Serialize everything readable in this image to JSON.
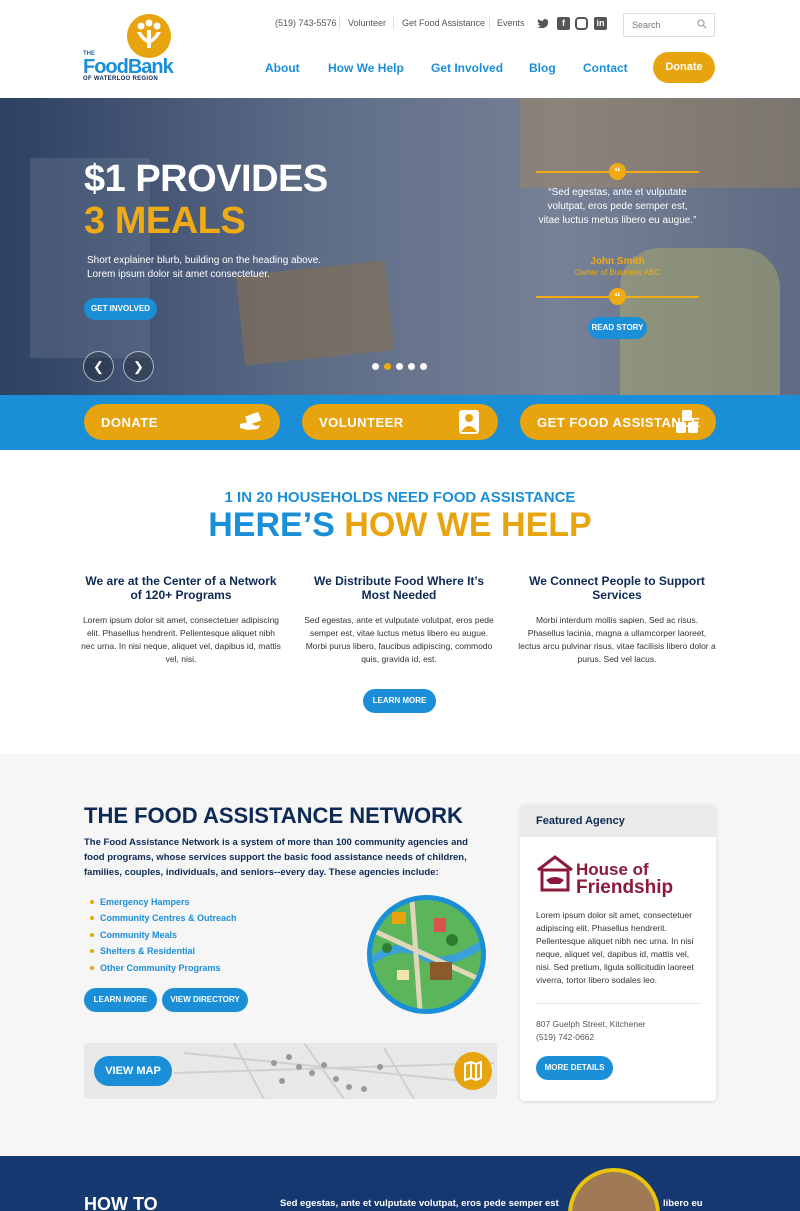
{
  "header": {
    "logo": {
      "the": "THE",
      "name": "FoodBank",
      "sub": "OF WATERLOO REGION"
    },
    "utility": {
      "phone": "(519) 743-5576",
      "volunteer": "Volunteer",
      "food_assistance": "Get Food Assistance",
      "events": "Events"
    },
    "social": [
      "twitter-icon",
      "facebook-icon",
      "instagram-icon",
      "linkedin-icon"
    ],
    "search_placeholder": "Search",
    "nav": [
      "About",
      "How We Help",
      "Get Involved",
      "Blog",
      "Contact"
    ],
    "donate": "Donate"
  },
  "hero": {
    "title1": "$1 PROVIDES",
    "title2": "3 MEALS",
    "blurb": "Short explainer blurb, building on the heading above. Lorem ipsum dolor sit amet consectetuer.",
    "cta": "GET INVOLVED",
    "quote": "“Sed egestas, ante et vulputate volutpat, eros pede semper est, vitae luctus metus libero eu augue.”",
    "quote_name": "John Smith",
    "quote_role": "Owner of Business ABC",
    "read_story": "READ STORY",
    "slides": 5,
    "active_slide": 2
  },
  "cta_band": [
    {
      "label": "DONATE",
      "icon": "hand-money-icon"
    },
    {
      "label": "VOLUNTEER",
      "icon": "volunteer-person-icon"
    },
    {
      "label": "GET FOOD ASSISTANCE",
      "icon": "food-cans-icon"
    }
  ],
  "help": {
    "kicker": "1 IN 20 HOUSEHOLDS NEED FOOD ASSISTANCE",
    "title_a": "HERE’S ",
    "title_b": "HOW WE HELP",
    "columns": [
      {
        "heading": "We are at the Center of a Network of 120+ Programs",
        "body": "Lorem ipsum dolor sit amet, consectetuer adipiscing elit. Phasellus hendrerit. Pellentesque aliquet nibh nec urna. In nisi neque, aliquet vel, dapibus id, mattis vel, nisi."
      },
      {
        "heading": "We Distribute Food Where It’s Most Needed",
        "body": "Sed egestas, ante et vulputate volutpat, eros pede semper est, vitae luctus metus libero eu augue. Morbi purus libero, faucibus adipiscing, commodo quis, gravida id, est."
      },
      {
        "heading": "We Connect People to Support Services",
        "body": "Morbi interdum mollis sapien. Sed ac risus. Phasellus lacinia, magna a ullamcorper laoreet, lectus arcu pulvinar risus, vitae facilisis libero dolor a purus. Sed vel lacus."
      }
    ],
    "learn_more": "LEARN MORE"
  },
  "network": {
    "title": "THE FOOD ASSISTANCE NETWORK",
    "intro": "The Food Assistance Network is a system of more than 100 community agencies and food programs, whose services support the basic food assistance needs of children, families, couples, individuals, and seniors--every day. These agencies include:",
    "items": [
      "Emergency Hampers",
      "Community Centres & Outreach",
      "Community Meals",
      "Shelters & Residential",
      "Other Community Programs"
    ],
    "learn_more": "LEARN MORE",
    "view_directory": "VIEW DIRECTORY",
    "view_map": "VIEW MAP"
  },
  "agency": {
    "heading": "Featured Agency",
    "logo_line1": "House of",
    "logo_line2": "Friendship",
    "body": "Lorem ipsum dolor sit amet, consectetuer adipiscing elit. Phasellus hendrerit. Pellentesque aliquet nibh nec urna. In nisi neque, aliquet vel, dapibus id, mattis vel, nisi. Sed pretium, ligula sollicitudin laoreet viverra, tortor libero sodales leo.",
    "address": "807 Guelph Street, Kitchener",
    "phone": "(519) 742-0662",
    "more": "MORE DETAILS"
  },
  "bottom": {
    "heading": "HOW TO",
    "text": "Sed egestas, ante et vulputate volutpat, eros pede semper est",
    "text_tail": "libero eu"
  },
  "colors": {
    "blue": "#1a8fd8",
    "gold": "#e8a40f",
    "navy": "#0d2a55"
  }
}
